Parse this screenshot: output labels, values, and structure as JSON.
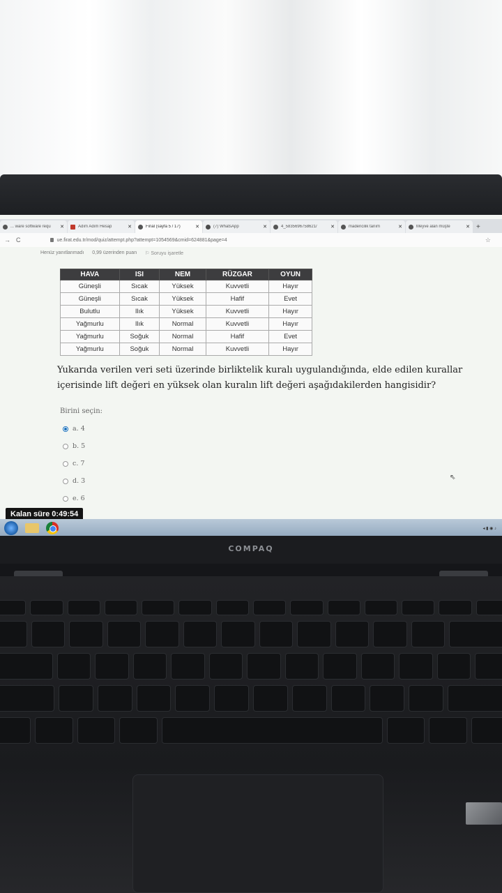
{
  "browser": {
    "tabs": [
      {
        "title": "... ware software requ",
        "icon": "page-icon",
        "active": false
      },
      {
        "title": "Adım Adım Hesap",
        "icon": "red-square-icon",
        "active": false
      },
      {
        "title": "Final (sayfa 5 / 17)",
        "icon": "moodle-icon",
        "active": true
      },
      {
        "title": "(7) WhatsApp",
        "icon": "whatsapp-icon",
        "active": false
      },
      {
        "title": "4_5835696758621/",
        "icon": "chrome-icon",
        "active": false
      },
      {
        "title": "madencilik tanım",
        "icon": "chrome-icon",
        "active": false
      },
      {
        "title": "Meyve alan müşte",
        "icon": "google-icon",
        "active": false
      }
    ],
    "url": "ue.firat.edu.tr/mod/quiz/attempt.php?attempt=1054569&cmid=624881&page=4"
  },
  "quiz_info": {
    "status": "Henüz yanıtlanmadı",
    "points": "0,99 üzerinden puan",
    "flag_label": "Soruyu işaretle"
  },
  "table": {
    "headers": [
      "HAVA",
      "ISI",
      "NEM",
      "RÜZGAR",
      "OYUN"
    ],
    "rows": [
      [
        "Güneşli",
        "Sıcak",
        "Yüksek",
        "Kuvvetli",
        "Hayır"
      ],
      [
        "Güneşli",
        "Sıcak",
        "Yüksek",
        "Hafif",
        "Evet"
      ],
      [
        "Bulutlu",
        "Ilık",
        "Yüksek",
        "Kuvvetli",
        "Hayır"
      ],
      [
        "Yağmurlu",
        "Ilık",
        "Normal",
        "Kuvvetli",
        "Hayır"
      ],
      [
        "Yağmurlu",
        "Soğuk",
        "Normal",
        "Hafif",
        "Evet"
      ],
      [
        "Yağmurlu",
        "Soğuk",
        "Normal",
        "Kuvvetli",
        "Hayır"
      ]
    ]
  },
  "question": {
    "text": "Yukarıda verilen veri seti üzerinde birliktelik kuralı uygulandığında, elde edilen kurallar içerisinde lift değeri en yüksek olan kuralın lift değeri aşağıdakilerden hangisidir?",
    "choose_label": "Birini seçin:",
    "options": [
      {
        "label": "a. 4",
        "selected": true
      },
      {
        "label": "b. 5",
        "selected": false
      },
      {
        "label": "c. 7",
        "selected": false
      },
      {
        "label": "d. 3",
        "selected": false
      },
      {
        "label": "e. 6",
        "selected": false
      }
    ]
  },
  "timer": {
    "label": "Kalan süre 0:49:54"
  },
  "laptop": {
    "brand": "COMPAQ"
  },
  "colors": {
    "table_header": "#3d3d3f",
    "radio_selected": "#1e73be",
    "timer_bg": "#141414"
  }
}
